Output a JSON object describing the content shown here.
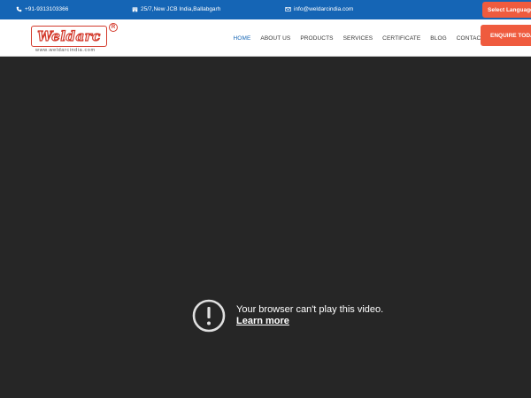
{
  "topbar": {
    "phone": "+91-9313103366",
    "address": "25/7,New JCB India,Ballabgarh",
    "email": "info@weldarcindia.com",
    "language_button": "Select Language"
  },
  "header": {
    "logo_text": "Weldarc",
    "logo_reg": "R",
    "logo_url": "www.weldarcindia.com",
    "nav": [
      {
        "label": "HOME"
      },
      {
        "label": "ABOUT US"
      },
      {
        "label": "PRODUCTS"
      },
      {
        "label": "SERVICES"
      },
      {
        "label": "CERTIFICATE"
      },
      {
        "label": "BLOG"
      },
      {
        "label": "CONTACT"
      }
    ],
    "enquire_button": "ENQUIRE TODAY"
  },
  "video": {
    "message": "Your browser can't play this video.",
    "learn_more": "Learn more"
  },
  "colors": {
    "topbar": "#1565b5",
    "accent": "#ef5b3e",
    "nav_active": "#1565b5",
    "video_bg": "#262626"
  }
}
